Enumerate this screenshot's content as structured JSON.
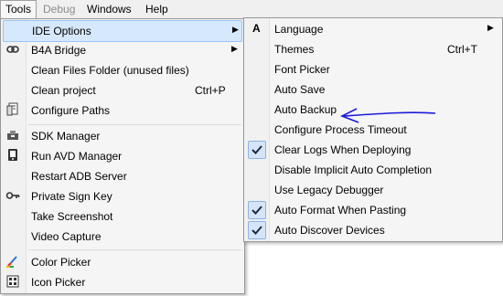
{
  "menubar": {
    "items": [
      "Tools",
      "Debug",
      "Windows",
      "Help"
    ]
  },
  "tools_menu": {
    "items": [
      {
        "label": "IDE Options",
        "icon": "none",
        "submenu": true
      },
      {
        "label": "B4A Bridge",
        "icon": "link-icon",
        "submenu": true
      },
      {
        "label": "Clean Files Folder (unused files)",
        "icon": "none"
      },
      {
        "label": "Clean project",
        "icon": "none",
        "shortcut": "Ctrl+P"
      },
      {
        "label": "Configure Paths",
        "icon": "paths-icon"
      },
      {
        "label": "SDK Manager",
        "icon": "sdk-icon"
      },
      {
        "label": "Run AVD Manager",
        "icon": "avd-icon"
      },
      {
        "label": "Restart ADB Server",
        "icon": "none"
      },
      {
        "label": "Private Sign Key",
        "icon": "key-icon"
      },
      {
        "label": "Take Screenshot",
        "icon": "none"
      },
      {
        "label": "Video Capture",
        "icon": "none"
      },
      {
        "label": "Color Picker",
        "icon": "color-picker-icon"
      },
      {
        "label": "Icon Picker",
        "icon": "icon-picker-icon"
      }
    ]
  },
  "ide_options_menu": {
    "items": [
      {
        "label": "Language",
        "icon": "font-icon",
        "submenu": true
      },
      {
        "label": "Themes",
        "shortcut": "Ctrl+T"
      },
      {
        "label": "Font Picker"
      },
      {
        "label": "Auto Save"
      },
      {
        "label": "Auto Backup"
      },
      {
        "label": "Configure Process Timeout"
      },
      {
        "label": "Clear Logs When Deploying",
        "checked": true
      },
      {
        "label": "Disable Implicit Auto Completion"
      },
      {
        "label": "Use Legacy Debugger"
      },
      {
        "label": "Auto Format When Pasting",
        "checked": true
      },
      {
        "label": "Auto Discover Devices",
        "checked": true
      }
    ]
  },
  "colors": {
    "highlight": "#d6e8fb",
    "annotation_arrow": "#1a1adc"
  }
}
